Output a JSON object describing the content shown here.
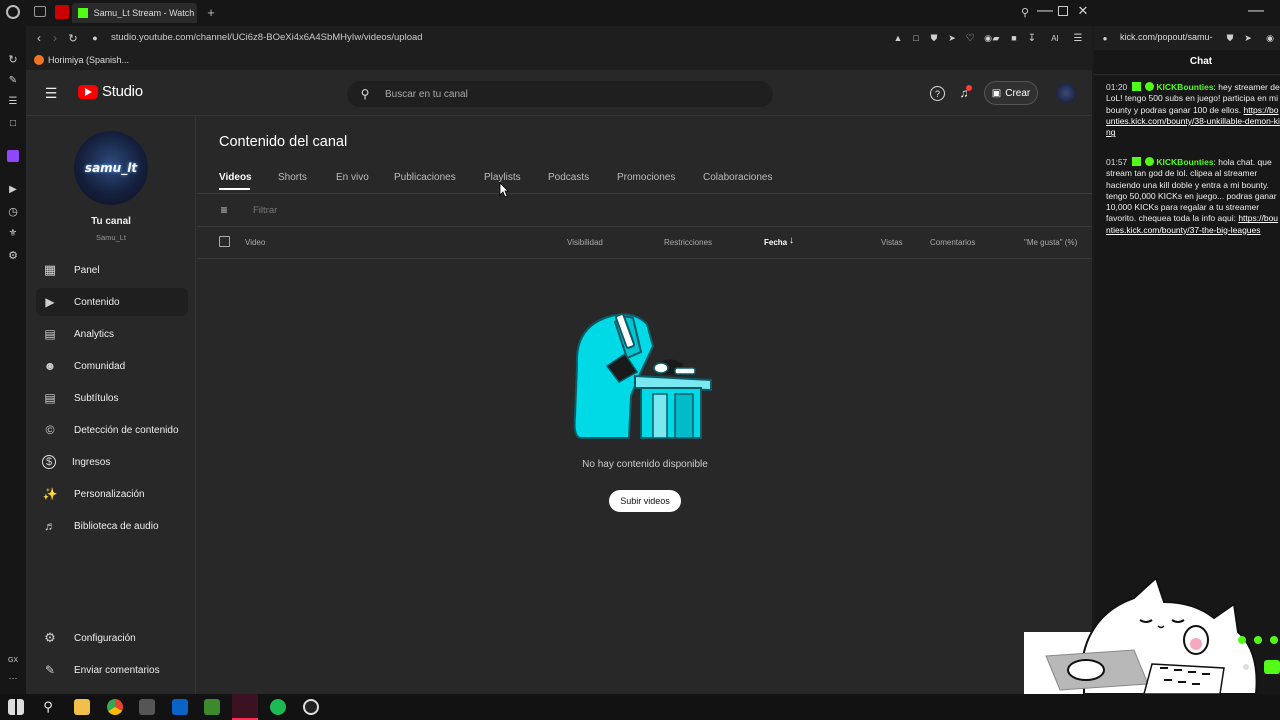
{
  "browser": {
    "tabs": [
      {
        "title": "Samu_Lt Stream - Watch L"
      }
    ],
    "url": "studio.youtube.com/channel/UCi6z8-BOeXi4x6A4SbMHyIw/videos/upload",
    "bookmark": "Horimiya (Spanish...",
    "right_url": "kick.com/popout/samu-"
  },
  "studio": {
    "logo": "Studio",
    "search_placeholder": "Buscar en tu canal",
    "create_label": "Crear",
    "channel": {
      "avatar_text": "samu_lt",
      "label": "Tu canal",
      "name": "Samu_Lt"
    },
    "nav": [
      {
        "label": "Panel",
        "icon": "dashboard-icon"
      },
      {
        "label": "Contenido",
        "icon": "content-icon",
        "active": true
      },
      {
        "label": "Analytics",
        "icon": "analytics-icon"
      },
      {
        "label": "Comunidad",
        "icon": "community-icon"
      },
      {
        "label": "Subtítulos",
        "icon": "subtitles-icon"
      },
      {
        "label": "Detección de contenido",
        "icon": "copyright-icon"
      },
      {
        "label": "Ingresos",
        "icon": "money-icon"
      },
      {
        "label": "Personalización",
        "icon": "customization-icon"
      },
      {
        "label": "Biblioteca de audio",
        "icon": "audio-library-icon"
      }
    ],
    "nav_bottom": [
      {
        "label": "Configuración",
        "icon": "gear-icon"
      },
      {
        "label": "Enviar comentarios",
        "icon": "feedback-icon"
      }
    ],
    "page_title": "Contenido del canal",
    "tabs": [
      "Videos",
      "Shorts",
      "En vivo",
      "Publicaciones",
      "Playlists",
      "Podcasts",
      "Promociones",
      "Colaboraciones"
    ],
    "filter_placeholder": "Filtrar",
    "columns": [
      "Video",
      "Visibilidad",
      "Restricciones",
      "Fecha",
      "Vistas",
      "Comentarios",
      "\"Me gusta\" (%)"
    ],
    "empty_text": "No hay contenido disponible",
    "upload_button": "Subir videos"
  },
  "chat": {
    "title": "Chat",
    "messages": [
      {
        "time": "01:20",
        "user": "KICKBounties",
        "text": "hey streamer de LoL! tengo 500 subs en juego! participa en mi bounty y podras ganar 100 de ellos.",
        "link": "https://bounties.kick.com/bounty/38-unkillable-demon-king"
      },
      {
        "time": "01:57",
        "user": "KICKBounties",
        "text": "hola chat. que stream tan god de lol. clipea al streamer haciendo una kill doble y entra a mi bounty. tengo 50,000 KICKs en juego... podras ganar 10,000 KICKs para regalar a tu streamer favorito. chequea toda la info aqui:",
        "link": "https://bounties.kick.com/bounty/37-the-big-leagues"
      }
    ]
  },
  "colors": {
    "kick_green": "#53fc18",
    "yt_red": "#ff0000",
    "studio_bg": "#282828",
    "illustration_cyan": "#00d9e6"
  }
}
